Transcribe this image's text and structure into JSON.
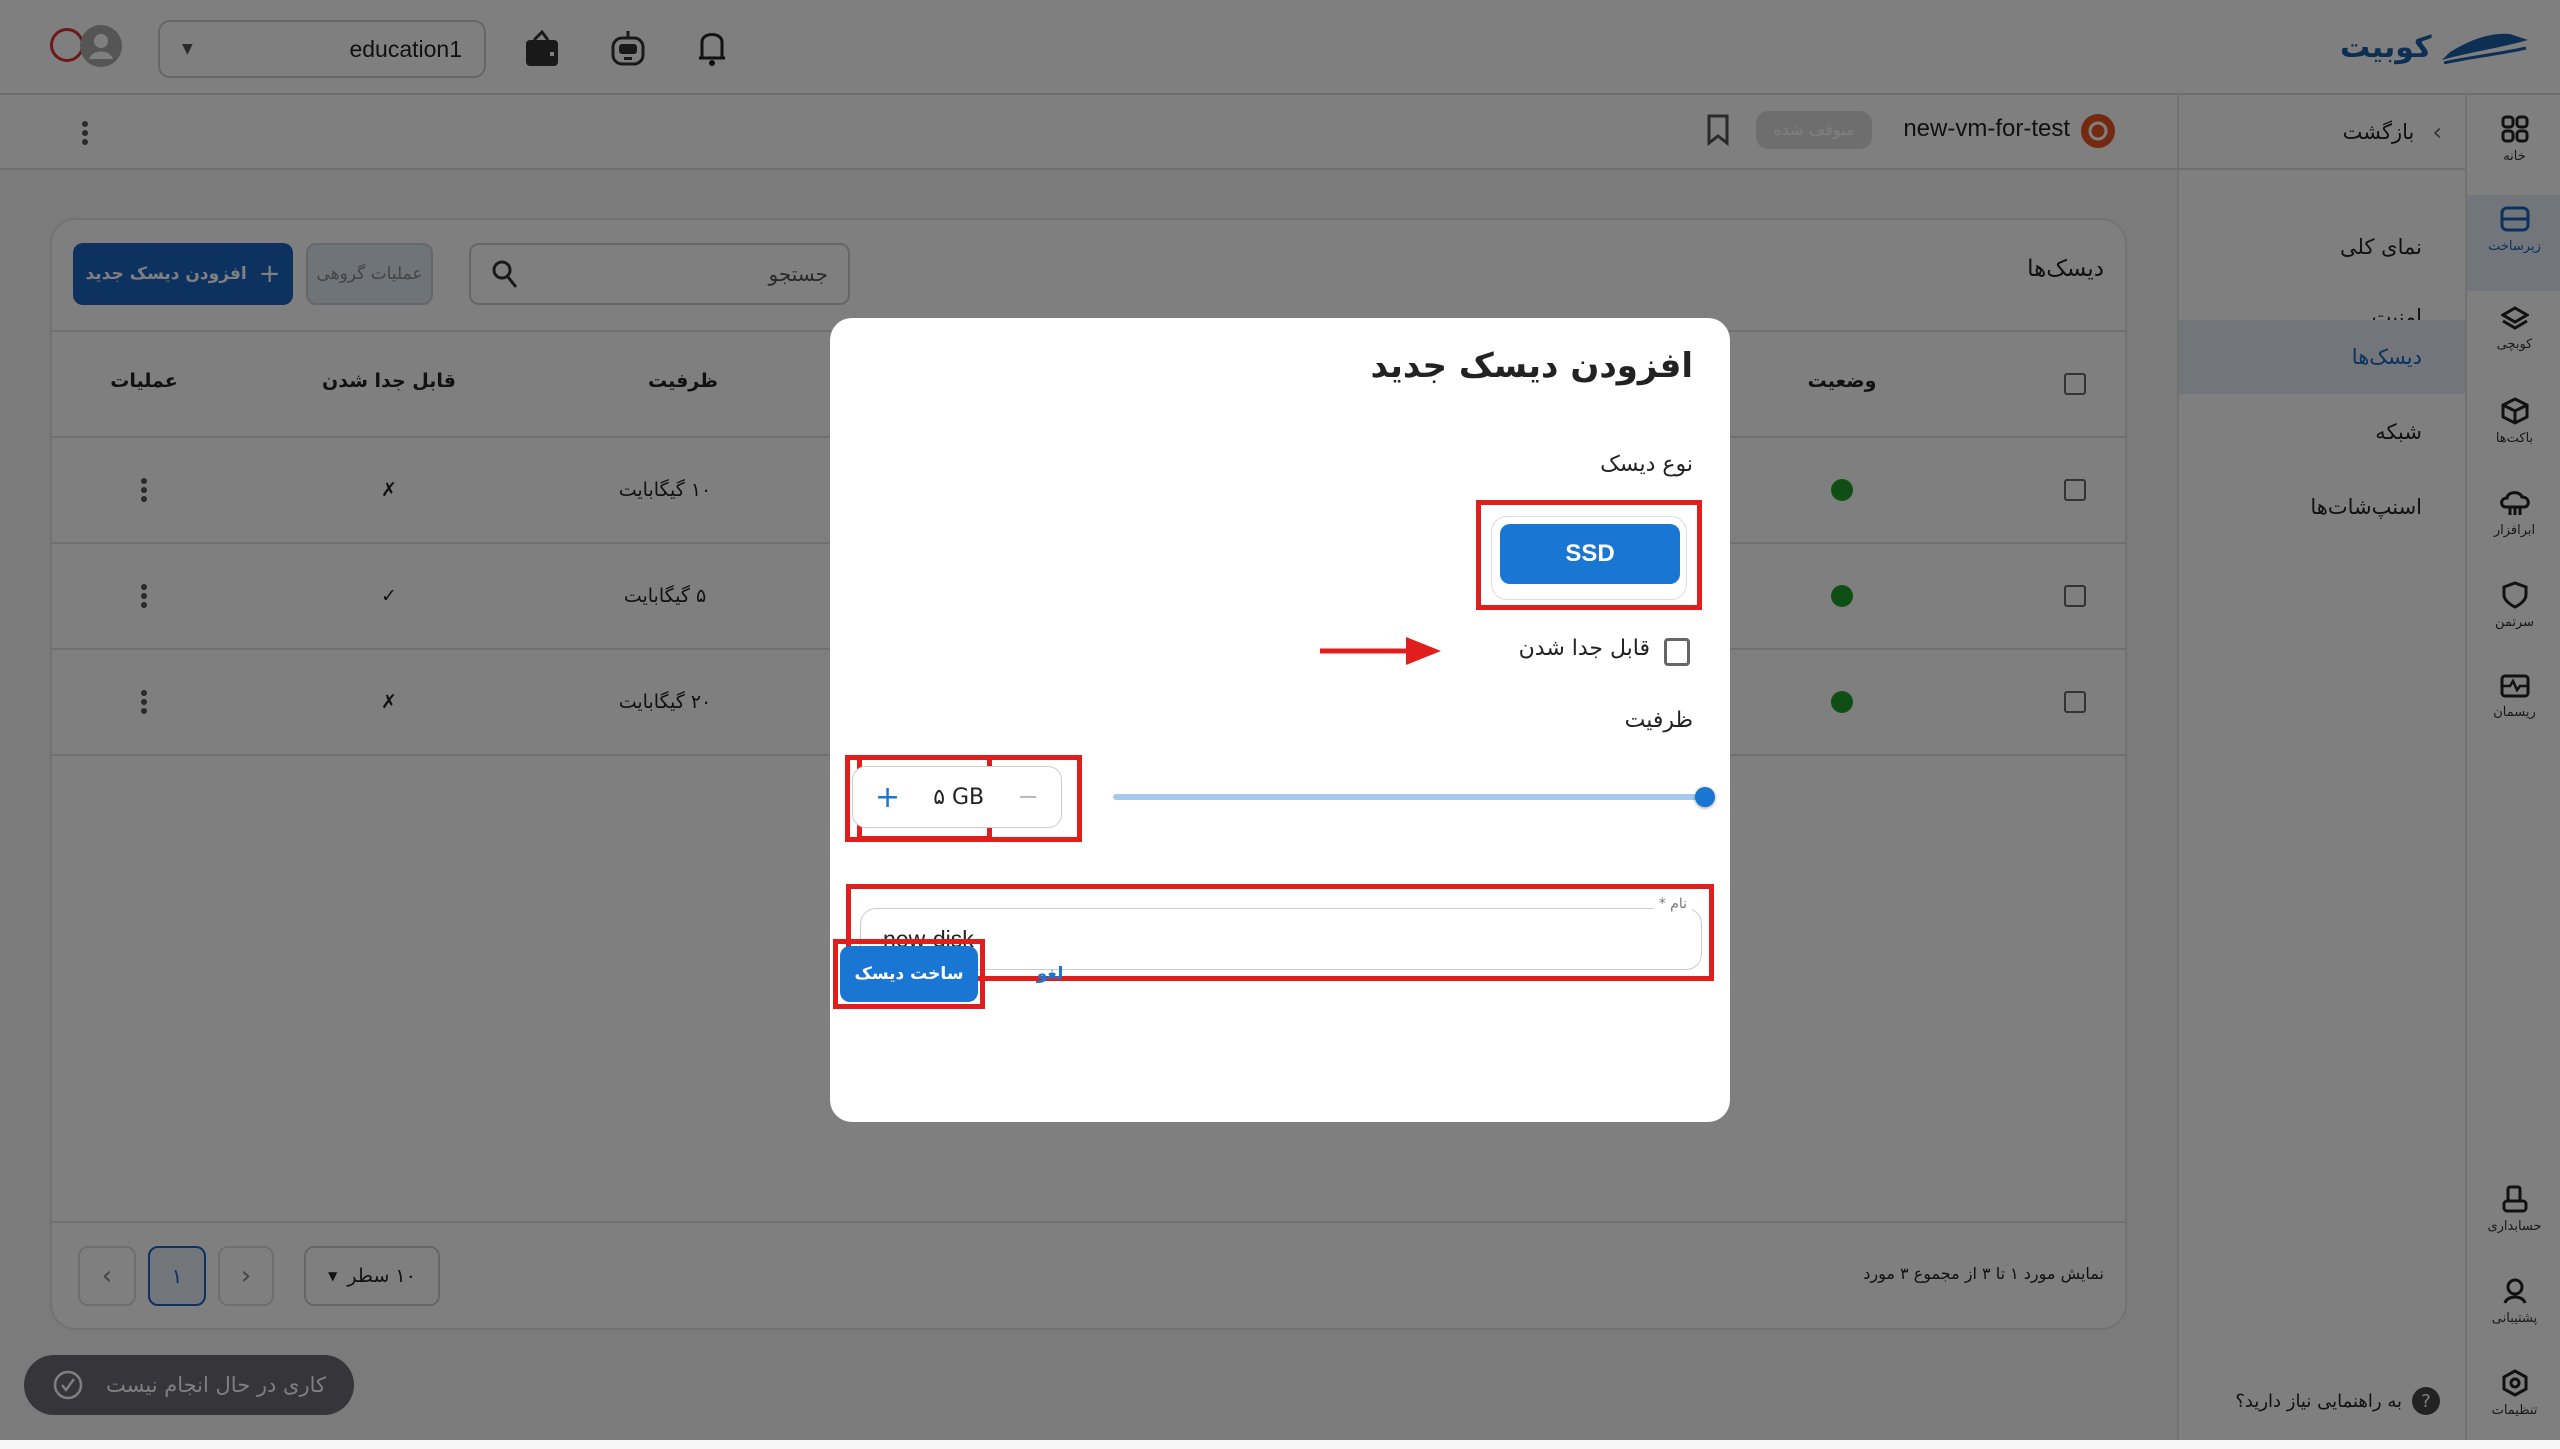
{
  "topbar": {
    "brand": "کوبیت",
    "project_select": "education1",
    "icons": [
      "wallet-icon",
      "robot-icon",
      "bell-icon"
    ]
  },
  "subbar": {
    "vm_name": "new-vm-for-test",
    "vm_status": "متوقف شده",
    "back_label": "بازگشت"
  },
  "rail": {
    "items": [
      {
        "label": "خانه",
        "icon": "grid-icon"
      },
      {
        "label": "زیرساخت",
        "icon": "server-icon",
        "active": true
      },
      {
        "label": "کوبچی",
        "icon": "layers-icon"
      },
      {
        "label": "باکت‌ها",
        "icon": "cube-icon"
      },
      {
        "label": "ابرافزار",
        "icon": "cloud-icon"
      },
      {
        "label": "سرتمن",
        "icon": "shield-icon"
      },
      {
        "label": "ریسمان",
        "icon": "pulse-icon"
      },
      {
        "label": "حسابداری",
        "icon": "accounting-icon"
      },
      {
        "label": "پشتیبانی",
        "icon": "support-icon"
      },
      {
        "label": "تنظیمات",
        "icon": "settings-icon"
      }
    ]
  },
  "subnav": {
    "items": [
      {
        "label": "نمای کلی"
      },
      {
        "label": "امنیت"
      },
      {
        "label": "دیسک‌ها",
        "active": true
      },
      {
        "label": "شبکه"
      },
      {
        "label": "اسنپ‌شات‌ها"
      }
    ]
  },
  "disks": {
    "title": "دیسک‌ها",
    "search_placeholder": "جستجو",
    "bulk_label": "عملیات گروهی",
    "add_label": "افزودن دیسک جدید",
    "columns": {
      "status": "وضعیت",
      "capacity": "ظرفیت",
      "detachable": "قابل جدا شدن",
      "actions": "عملیات"
    },
    "rows": [
      {
        "status": "green",
        "capacity": "۱۰ گیگابایت",
        "detachable": "✗"
      },
      {
        "status": "green",
        "capacity": "۵ گیگابایت",
        "detachable": "✓"
      },
      {
        "status": "green",
        "capacity": "۲۰ گیگابایت",
        "detachable": "✗"
      }
    ],
    "summary": "نمایش مورد ۱ تا ۳ از مجموع ۳ مورد",
    "rows_per_page": "۱۰ سطر",
    "page": "۱"
  },
  "toast": "کاری در حال انجام نیست",
  "help": "به راهنمایی نیاز دارید؟",
  "dialog": {
    "title": "افزودن دیسک جدید",
    "disk_type_label": "نوع دیسک",
    "disk_type": "SSD",
    "detachable_label": "قابل جدا شدن",
    "detachable_checked": false,
    "capacity_label": "ظرفیت",
    "capacity_value": "۵ GB",
    "slider_fraction": 1.0,
    "name_label": "نام *",
    "name_value": "new-disk",
    "create_label": "ساخت دیسک",
    "cancel_label": "لغو"
  },
  "colors": {
    "primary": "#1976d2",
    "highlight": "#e01e1e",
    "status_ok": "#1e9e2a"
  }
}
